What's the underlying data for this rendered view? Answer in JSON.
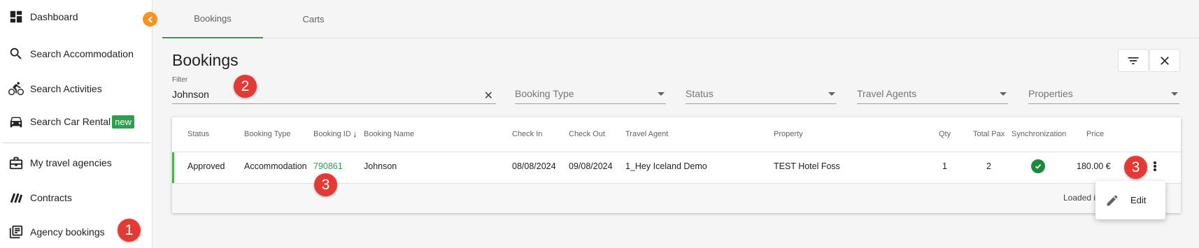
{
  "sidebar": {
    "items": [
      {
        "label": "Dashboard",
        "icon": "dashboard-icon"
      },
      {
        "label": "Search Accommodation",
        "icon": "search-icon"
      },
      {
        "label": "Search Activities",
        "icon": "bicycle-icon"
      },
      {
        "label": "Search Car Rental",
        "icon": "car-icon",
        "badge": "new"
      },
      {
        "label": "My travel agencies",
        "icon": "briefcase-icon"
      },
      {
        "label": "Contracts",
        "icon": "contracts-icon"
      },
      {
        "label": "Agency bookings",
        "icon": "bookings-icon"
      }
    ]
  },
  "tabs": [
    {
      "label": "Bookings",
      "active": true
    },
    {
      "label": "Carts",
      "active": false
    }
  ],
  "page": {
    "title": "Bookings"
  },
  "filters": {
    "filter": {
      "label": "Filter",
      "value": "Johnson"
    },
    "booking_type": {
      "placeholder": "Booking Type"
    },
    "status": {
      "placeholder": "Status"
    },
    "travel_agents": {
      "placeholder": "Travel Agents"
    },
    "properties": {
      "placeholder": "Properties"
    }
  },
  "table": {
    "columns": [
      "Status",
      "Booking Type",
      "Booking ID",
      "Booking Name",
      "Check In",
      "Check Out",
      "Travel Agent",
      "Property",
      "Qty",
      "Total Pax",
      "Synchronization",
      "Price"
    ],
    "sort_indicator": "↓",
    "rows": [
      {
        "status": "Approved",
        "booking_type": "Accommodation",
        "booking_id": "790861",
        "booking_name": "Johnson",
        "check_in": "08/08/2024",
        "check_out": "09/08/2024",
        "travel_agent": "1_Hey Iceland Demo",
        "property": "TEST Hotel Foss",
        "qty": "1",
        "total_pax": "2",
        "synchronization": "synced",
        "price": "180.00 €"
      }
    ],
    "footer_text": "Loaded i"
  },
  "menu": {
    "edit_label": "Edit"
  },
  "markers": [
    "1",
    "2",
    "3",
    "3"
  ],
  "colors": {
    "accent": "#2e9e4f",
    "marker": "#e53935",
    "collapse": "#f7931e"
  }
}
